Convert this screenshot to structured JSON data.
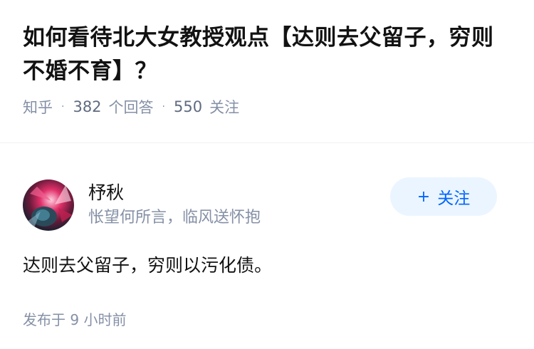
{
  "question": {
    "title": "如何看待北大女教授观点【达则去父留子，穷则不婚不育】？",
    "source": "知乎",
    "answer_count": "382",
    "answer_label": "个回答",
    "follow_count": "550",
    "follow_label": "关注"
  },
  "author": {
    "name": "杼秋",
    "bio": "怅望何所言，临风送怀抱",
    "avatar_icon": "avatar-image",
    "follow_button": {
      "icon": "+",
      "label": "关注",
      "bg_color": "#ebf5ff",
      "text_color": "#0066ff"
    }
  },
  "answer": {
    "content": "达则去父留子，穷则以污化债。",
    "published": "发布于 9 小时前"
  }
}
